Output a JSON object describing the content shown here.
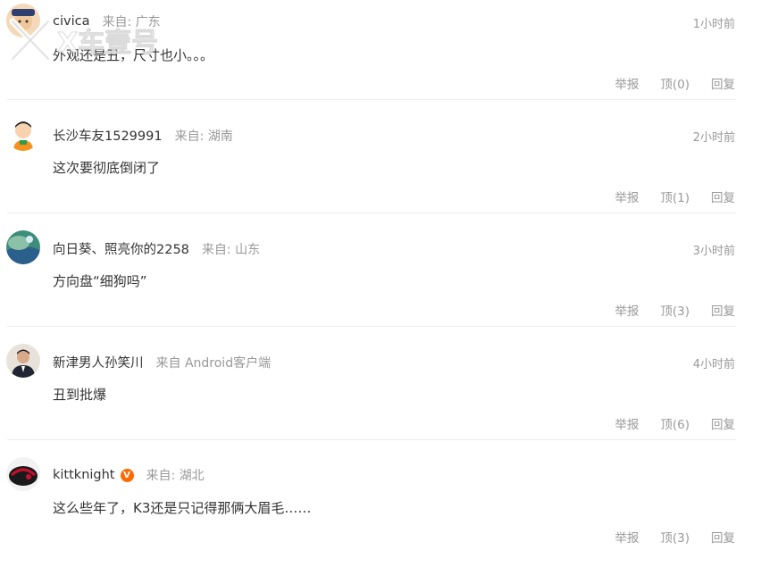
{
  "comments": [
    {
      "user": "civica",
      "from": "来自: 广东",
      "time": "1小时前",
      "content": "外观还是丑，尺寸也小。。。",
      "report": "举报",
      "upvote": "顶(0)",
      "reply": "回复",
      "verified": false
    },
    {
      "user": "长沙车友1529991",
      "from": "来自: 湖南",
      "time": "2小时前",
      "content": "这次要彻底倒闭了",
      "report": "举报",
      "upvote": "顶(1)",
      "reply": "回复",
      "verified": false
    },
    {
      "user": "向日葵、照亮你的2258",
      "from": "来自: 山东",
      "time": "3小时前",
      "content": "方向盘“细狗吗”",
      "report": "举报",
      "upvote": "顶(3)",
      "reply": "回复",
      "verified": false
    },
    {
      "user": "新津男人孙笑川",
      "from": "来自 Android客户端",
      "time": "4小时前",
      "content": "丑到批爆",
      "report": "举报",
      "upvote": "顶(6)",
      "reply": "回复",
      "verified": false
    },
    {
      "user": "kittknight",
      "from": "来自: 湖北",
      "time": "",
      "content": "这么些年了，K3还是只记得那俩大眉毛……",
      "report": "举报",
      "upvote": "顶(3)",
      "reply": "回复",
      "verified": true,
      "verified_mark": "V"
    }
  ],
  "watermark": "X车壹号",
  "colors": {
    "text": "#333333",
    "muted": "#999999",
    "divider": "#ececec",
    "badge": "#ff6a00"
  }
}
